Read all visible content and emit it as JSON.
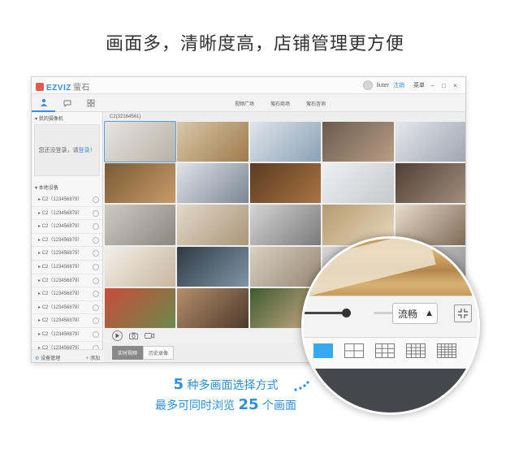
{
  "headline": "画面多，清晰度高，店铺管理更方便",
  "app": {
    "brand": "EZVIZ",
    "brand_sub": "萤石",
    "user": "liuter",
    "logout_label": "注销",
    "menu_label": "菜单",
    "window_controls": {
      "minimize": "–",
      "restore": "□",
      "close": "×"
    },
    "nav_links": [
      "视频广场",
      "萤石商场",
      "萤石咨询"
    ],
    "sidebar": {
      "my_cameras_label": "我的摄像机",
      "login_prompt": "您还没登录，请",
      "login_link": "登录",
      "login_suffix": "！",
      "local_devices_label": "本地设备",
      "devices": [
        "C2（123456879）",
        "C2（123456879）",
        "C2（123456879）",
        "C2（123456879）",
        "C2（123456879）",
        "C2（123456879）",
        "C2（123456879）",
        "C2（123456879）",
        "C2（123456879）",
        "C2（123456879）",
        "C2（123456879）",
        "C2（123456879）"
      ],
      "device_manage_label": "设备管理",
      "add_label": "添加"
    },
    "main": {
      "camera_title": "C2(32164561)",
      "tabs": [
        "实时视频",
        "历史录像"
      ]
    }
  },
  "zoom": {
    "quality_label": "流畅",
    "slider_level": 0.4,
    "layouts": [
      "1",
      "4",
      "9",
      "16",
      "25"
    ]
  },
  "caption": {
    "line1_num": "5",
    "line1_text": "种多画面选择方式",
    "line2_prefix": "最多可同时浏览",
    "line2_num": "25",
    "line2_suffix": "个画面"
  },
  "colors": {
    "accent": "#3a8ee6",
    "caption": "#2f8fd8",
    "active_layout": "#35aaf2"
  },
  "tiles": [
    {
      "c1": "#e8e6e1",
      "c2": "#b7b1a5"
    },
    {
      "c1": "#d9c8a8",
      "c2": "#9e7b4d"
    },
    {
      "c1": "#e0e5ea",
      "c2": "#8aa1b6"
    },
    {
      "c1": "#6b5a4b",
      "c2": "#b89f86"
    },
    {
      "c1": "#e5e7eb",
      "c2": "#9ea6b0"
    },
    {
      "c1": "#7a5a38",
      "c2": "#c79b66"
    },
    {
      "c1": "#dfe3e8",
      "c2": "#7b8794"
    },
    {
      "c1": "#5a3b22",
      "c2": "#a97442"
    },
    {
      "c1": "#eef0f2",
      "c2": "#c6c9cc"
    },
    {
      "c1": "#4e3f35",
      "c2": "#a28e7c"
    },
    {
      "c1": "#cfcac2",
      "c2": "#8c877e"
    },
    {
      "c1": "#e3d8c7",
      "c2": "#a9967a"
    },
    {
      "c1": "#d5d5d5",
      "c2": "#7a7a7a"
    },
    {
      "c1": "#b59a70",
      "c2": "#e8d9bd"
    },
    {
      "c1": "#e9dccb",
      "c2": "#7d6a55"
    },
    {
      "c1": "#f2efe9",
      "c2": "#c8b89e"
    },
    {
      "c1": "#2f3a44",
      "c2": "#7f95a6"
    },
    {
      "c1": "#d9d0c3",
      "c2": "#96876f"
    },
    {
      "c1": "#d6d6d6",
      "c2": "#8e8e8e"
    },
    {
      "c1": "#d6d6d6",
      "c2": "#8e8e8e"
    },
    {
      "c1": "#c94b3a",
      "c2": "#6a8a4d"
    },
    {
      "c1": "#b58e6a",
      "c2": "#4d3a2c"
    },
    {
      "c1": "#3c5a2e",
      "c2": "#d2b08a"
    },
    {
      "c1": "#d6d6d6",
      "c2": "#8e8e8e"
    },
    {
      "c1": "#d6d6d6",
      "c2": "#8e8e8e"
    }
  ]
}
